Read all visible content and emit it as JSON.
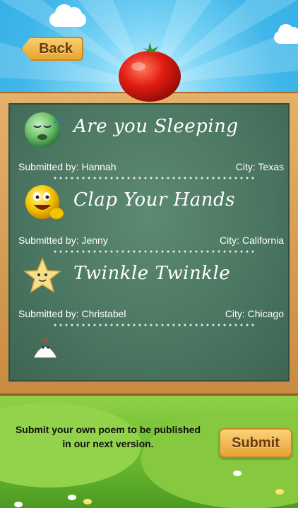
{
  "header": {
    "back_label": "Back"
  },
  "poems": [
    {
      "title": "Are you Sleeping",
      "submitted_by": "Submitted by:  Hannah",
      "city": "City: Texas",
      "icon": "sleeping-ball-icon"
    },
    {
      "title": "Clap Your Hands",
      "submitted_by": "Submitted by: Jenny",
      "city": "City: California",
      "icon": "clapping-smiley-icon"
    },
    {
      "title": "Twinkle Twinkle",
      "submitted_by": "Submitted by: Christabel",
      "city": "City: Chicago",
      "icon": "star-icon"
    }
  ],
  "footer": {
    "prompt_line1": "Submit your own poem to be published",
    "prompt_line2": "in our next version.",
    "submit_label": "Submit"
  },
  "colors": {
    "board": "#4a7560",
    "frame": "#d9a258",
    "button": "#f2b94f",
    "sky": "#40b7ea",
    "grass": "#7cc63c"
  }
}
